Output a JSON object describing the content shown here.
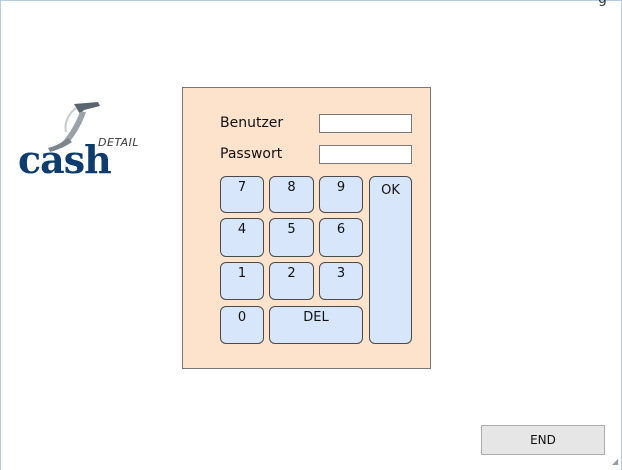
{
  "window": {
    "top_glyph": "g"
  },
  "logo": {
    "wordmark": "cash",
    "sub": "DETAIL"
  },
  "login": {
    "user_label": "Benutzer",
    "user_value": "",
    "password_label": "Passwort",
    "password_value": ""
  },
  "keypad": {
    "keys": [
      "7",
      "8",
      "9",
      "4",
      "5",
      "6",
      "1",
      "2",
      "3",
      "0"
    ],
    "delete_label": "DEL",
    "ok_label": "OK"
  },
  "footer": {
    "end_label": "END"
  },
  "colors": {
    "panel_bg": "#fde3cc",
    "key_bg": "#d8e6fb",
    "logo_blue": "#0f3c6e",
    "frame_border": "#b8cbe6"
  }
}
